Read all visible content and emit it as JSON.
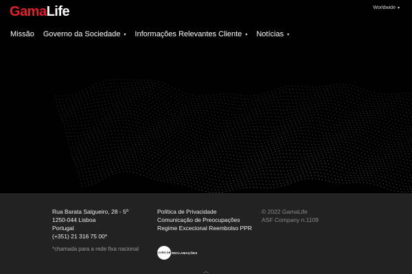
{
  "header": {
    "logo_gama": "Gama",
    "logo_life": "Life",
    "language": "Worldwide"
  },
  "nav": [
    {
      "label": "Missão",
      "has_menu": false
    },
    {
      "label": "Governo da Sociedade",
      "has_menu": true
    },
    {
      "label": "Informações Relevantes Cliente",
      "has_menu": true
    },
    {
      "label": "Notícias",
      "has_menu": true
    }
  ],
  "footer": {
    "address": [
      "Rua Barata Salgueiro, 28 - 5º",
      "1250-044 Lisboa",
      "Portugal"
    ],
    "phone": "(+351) 21 316 75 00*",
    "note": "*chamada para a rede fixa nacional",
    "links": [
      "Política de Privacidade",
      "Comunicação de Preocupações",
      "Regime Excecional Reembolso PPR"
    ],
    "copyright": "© 2022 GamaLife",
    "company": "ASF Company n.1109",
    "complaints_book_circle": "LIVRO DE",
    "complaints_book_label": "RECLAMAÇÕES"
  },
  "colors": {
    "accent": "#e3202c",
    "footer_bg": "#222222",
    "background": "#000000"
  }
}
